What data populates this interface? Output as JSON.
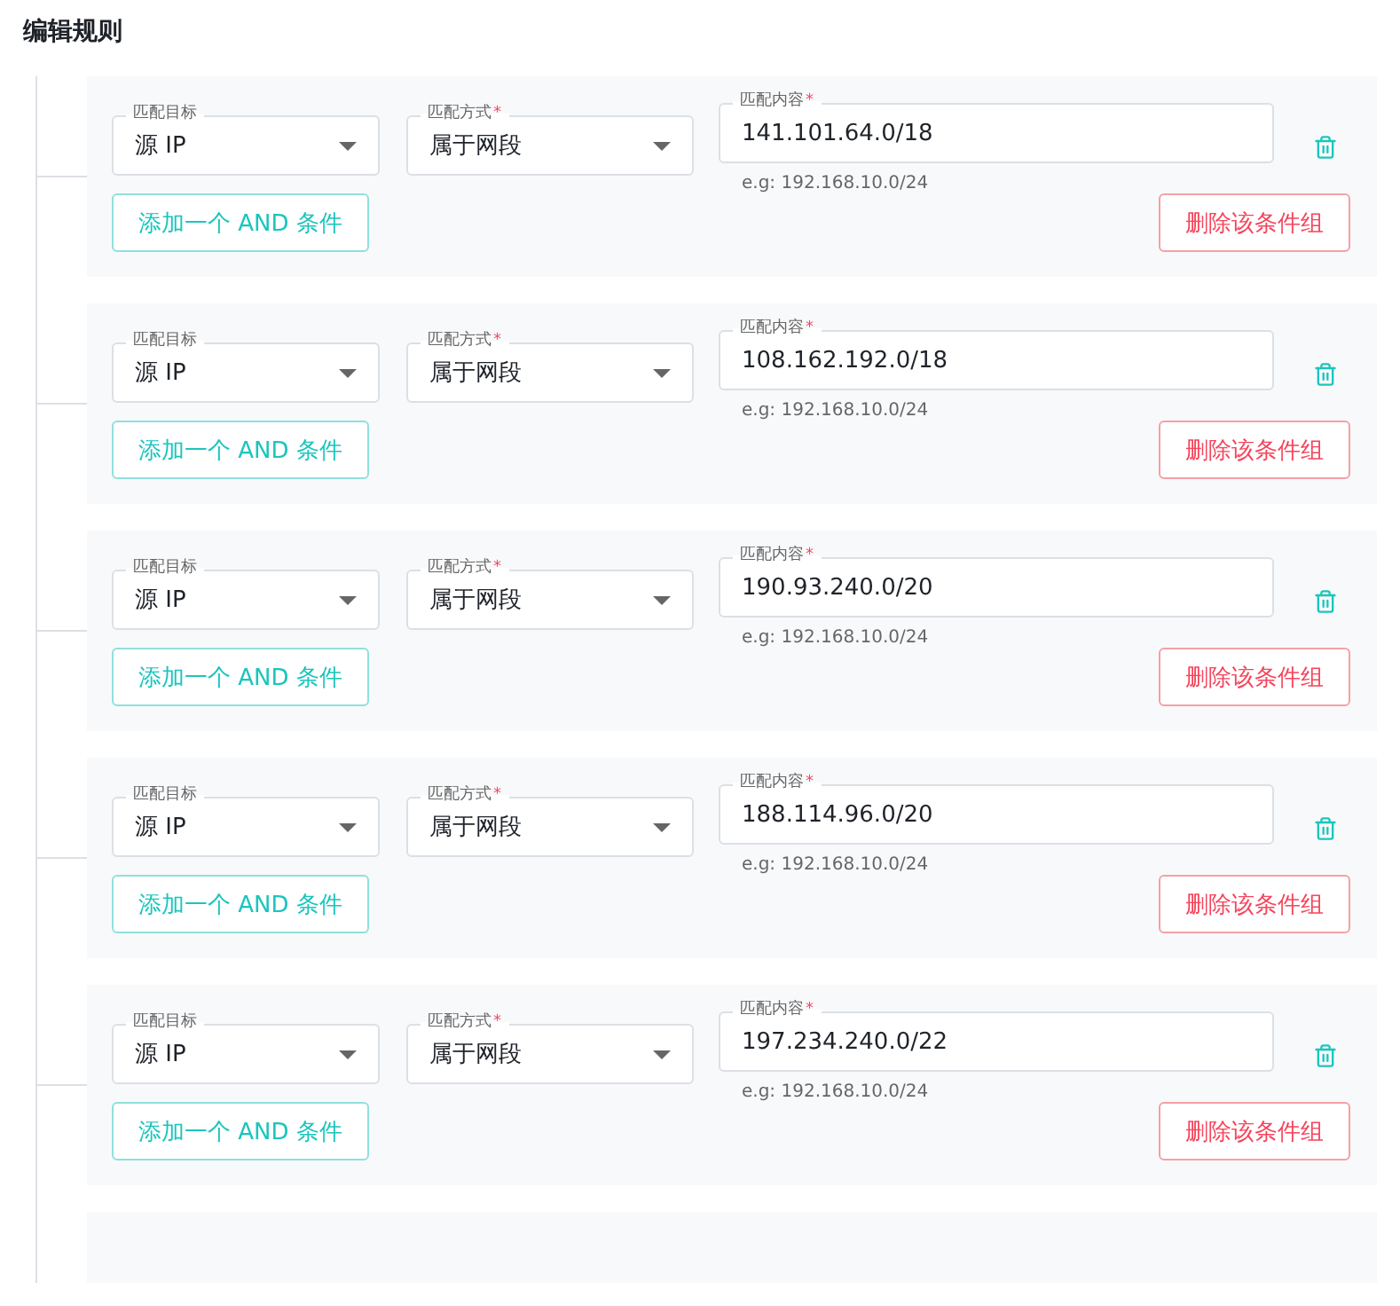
{
  "title": "编辑规则",
  "rule_groups": [
    {
      "conditions": [
        {
          "target": {
            "label": "匹配目标",
            "value": "源 IP"
          },
          "method": {
            "label": "匹配方式",
            "required_mark": "*",
            "value": "属于网段"
          },
          "content": {
            "label": "匹配内容",
            "required_mark": "*",
            "value": "141.101.64.0/18",
            "hint": "e.g: 192.168.10.0/24"
          }
        }
      ],
      "add_button": "添加一个 AND 条件",
      "delete_button": "删除该条件组"
    },
    {
      "conditions": [
        {
          "target": {
            "label": "匹配目标",
            "value": "源 IP"
          },
          "method": {
            "label": "匹配方式",
            "required_mark": "*",
            "value": "属于网段"
          },
          "content": {
            "label": "匹配内容",
            "required_mark": "*",
            "value": "108.162.192.0/18",
            "hint": "e.g: 192.168.10.0/24"
          }
        }
      ],
      "add_button": "添加一个 AND 条件",
      "delete_button": "删除该条件组"
    },
    {
      "conditions": [
        {
          "target": {
            "label": "匹配目标",
            "value": "源 IP"
          },
          "method": {
            "label": "匹配方式",
            "required_mark": "*",
            "value": "属于网段"
          },
          "content": {
            "label": "匹配内容",
            "required_mark": "*",
            "value": "190.93.240.0/20",
            "hint": "e.g: 192.168.10.0/24"
          }
        }
      ],
      "add_button": "添加一个 AND 条件",
      "delete_button": "删除该条件组"
    },
    {
      "conditions": [
        {
          "target": {
            "label": "匹配目标",
            "value": "源 IP"
          },
          "method": {
            "label": "匹配方式",
            "required_mark": "*",
            "value": "属于网段"
          },
          "content": {
            "label": "匹配内容",
            "required_mark": "*",
            "value": "188.114.96.0/20",
            "hint": "e.g: 192.168.10.0/24"
          }
        }
      ],
      "add_button": "添加一个 AND 条件",
      "delete_button": "删除该条件组"
    },
    {
      "conditions": [
        {
          "target": {
            "label": "匹配目标",
            "value": "源 IP"
          },
          "method": {
            "label": "匹配方式",
            "required_mark": "*",
            "value": "属于网段"
          },
          "content": {
            "label": "匹配内容",
            "required_mark": "*",
            "value": "197.234.240.0/22",
            "hint": "e.g: 192.168.10.0/24"
          }
        }
      ],
      "add_button": "添加一个 AND 条件",
      "delete_button": "删除该条件组"
    }
  ]
}
